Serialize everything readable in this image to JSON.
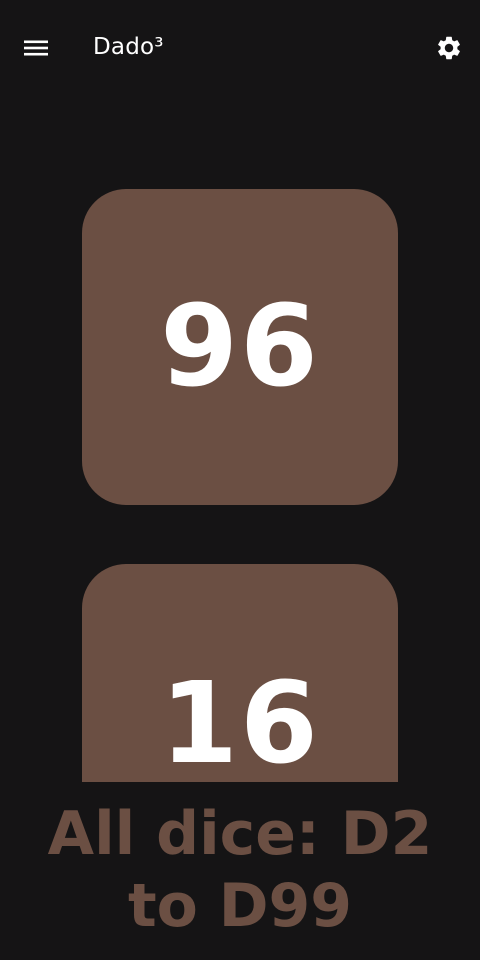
{
  "app_bar": {
    "title": "Dado³",
    "menu_icon": "hamburger-menu-icon",
    "settings_icon": "gear-icon"
  },
  "dice": [
    {
      "value": "96"
    },
    {
      "value": "16"
    }
  ],
  "promo": {
    "line1": "All dice: D2",
    "line2": "to D99"
  },
  "colors": {
    "background": "#151415",
    "die": "#6b4f43",
    "die_text": "#ffffff",
    "promo_text": "#6b4f43"
  }
}
